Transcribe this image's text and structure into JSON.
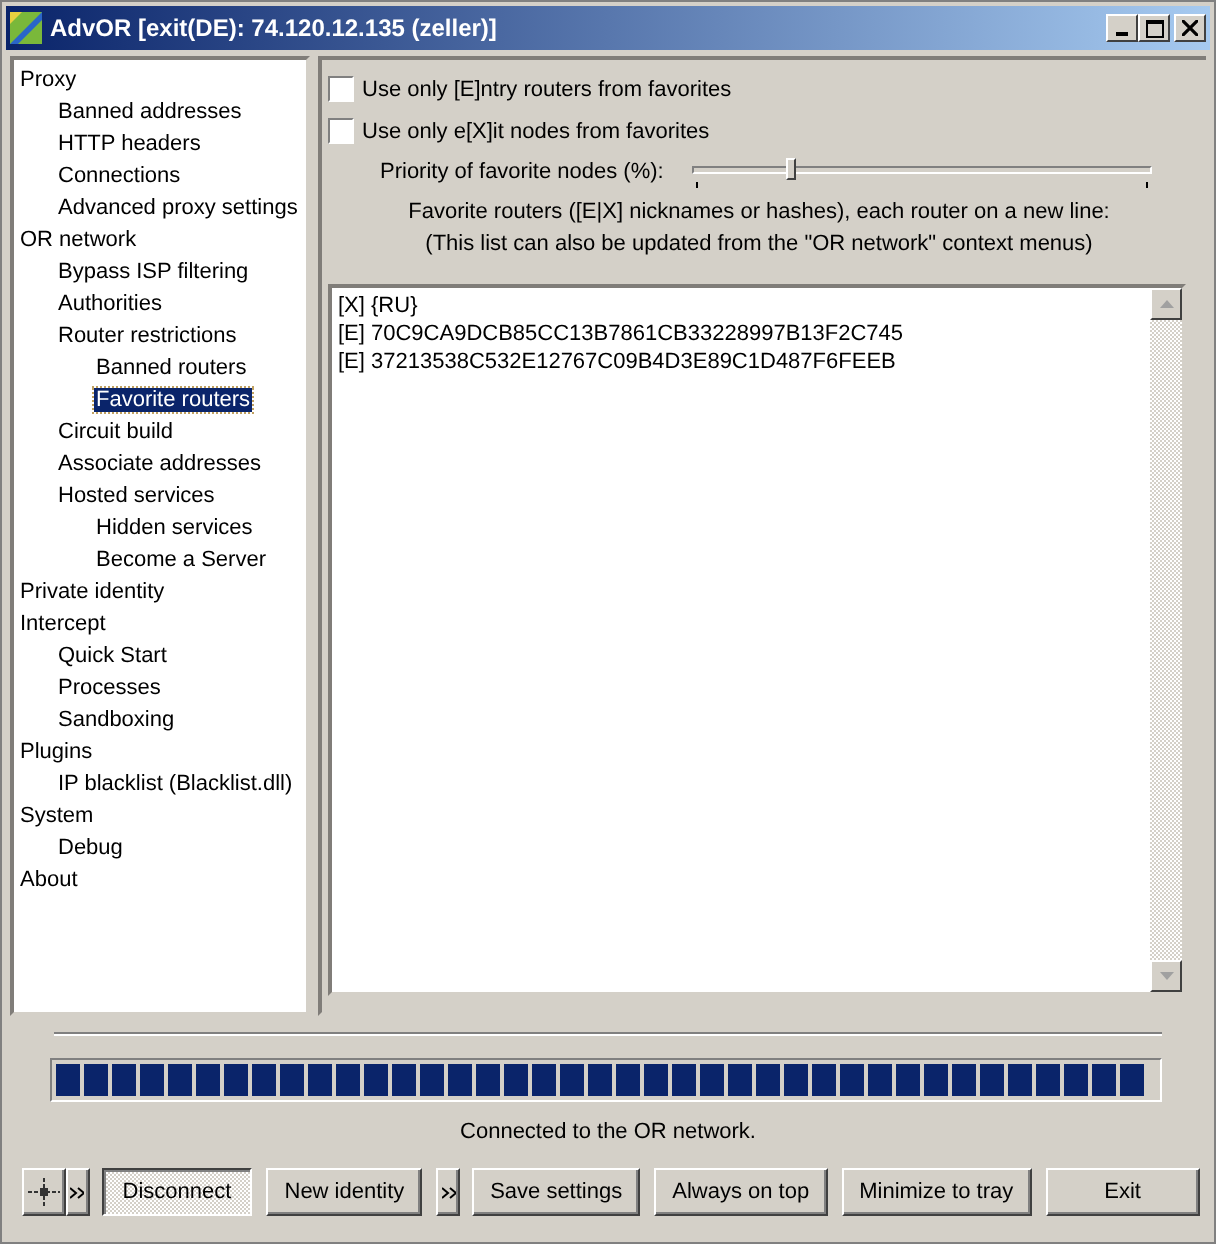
{
  "window": {
    "title": "AdvOR [exit(DE): 74.120.12.135 (zeller)]"
  },
  "tree": {
    "items": [
      {
        "label": "Proxy",
        "selected": false,
        "children": [
          {
            "label": "Banned addresses",
            "selected": false
          },
          {
            "label": "HTTP headers",
            "selected": false
          },
          {
            "label": "Connections",
            "selected": false
          },
          {
            "label": "Advanced proxy settings",
            "selected": false
          }
        ]
      },
      {
        "label": "OR network",
        "selected": false,
        "children": [
          {
            "label": "Bypass ISP filtering",
            "selected": false
          },
          {
            "label": "Authorities",
            "selected": false
          },
          {
            "label": "Router restrictions",
            "selected": false,
            "children": [
              {
                "label": "Banned routers",
                "selected": false
              },
              {
                "label": "Favorite routers",
                "selected": true
              }
            ]
          },
          {
            "label": "Circuit build",
            "selected": false
          },
          {
            "label": "Associate addresses",
            "selected": false
          },
          {
            "label": "Hosted services",
            "selected": false,
            "children": [
              {
                "label": "Hidden services",
                "selected": false
              },
              {
                "label": "Become a Server",
                "selected": false
              }
            ]
          }
        ]
      },
      {
        "label": "Private identity",
        "selected": false
      },
      {
        "label": "Intercept",
        "selected": false,
        "children": [
          {
            "label": "Quick Start",
            "selected": false
          },
          {
            "label": "Processes",
            "selected": false
          },
          {
            "label": "Sandboxing",
            "selected": false
          }
        ]
      },
      {
        "label": "Plugins",
        "selected": false,
        "children": [
          {
            "label": "IP blacklist (Blacklist.dll)",
            "selected": false
          }
        ]
      },
      {
        "label": "System",
        "selected": false,
        "children": [
          {
            "label": "Debug",
            "selected": false
          }
        ]
      },
      {
        "label": "About",
        "selected": false
      }
    ]
  },
  "options": [
    {
      "label": "Use only [E]ntry routers from favorites",
      "checked": false
    },
    {
      "label": "Use only e[X]it nodes from favorites",
      "checked": false
    }
  ],
  "priority": {
    "label": "Priority of favorite nodes (%):",
    "level": 0.22
  },
  "description": [
    "Favorite routers ([E|X] nicknames or hashes), each router on a new line:",
    "(This list can also be updated from the \"OR network\" context menus)"
  ],
  "favorites": [
    "[X] {RU}",
    "[E] 70C9CA9DCB85CC13B7861CB33228997B13F2C745",
    "[E] 37213538C532E12767C09B4D3E89C1D487F6FEEB"
  ],
  "progress": {
    "level": 1
  },
  "status": "Connected to the OR network.",
  "buttons": [
    {
      "kind": "icon"
    },
    {
      "kind": "more"
    },
    {
      "kind": "text",
      "label": "Disconnect",
      "pressed": true
    },
    {
      "kind": "text",
      "label": "New identity",
      "pressed": false
    },
    {
      "kind": "more"
    },
    {
      "kind": "text",
      "label": "Save settings",
      "pressed": false
    },
    {
      "kind": "text",
      "label": "Always on top",
      "pressed": false
    },
    {
      "kind": "text",
      "label": "Minimize to tray",
      "pressed": false
    },
    {
      "kind": "text",
      "label": "Exit",
      "pressed": false
    }
  ]
}
